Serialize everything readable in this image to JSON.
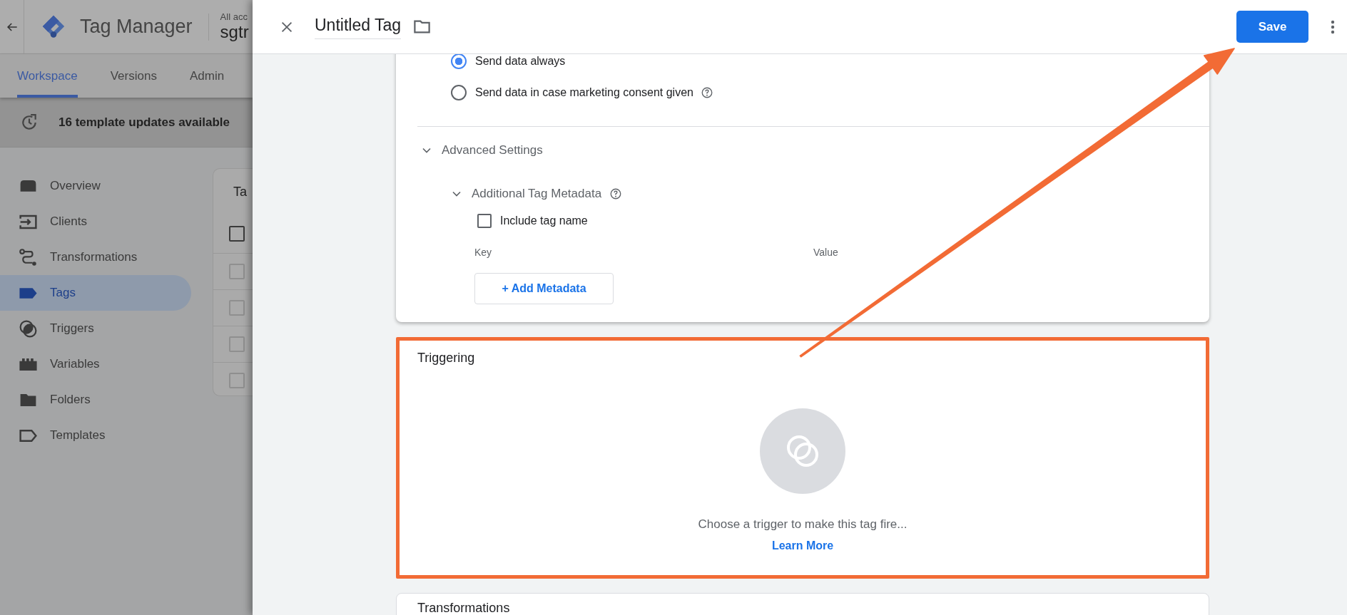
{
  "app": {
    "title": "Tag Manager",
    "account_label": "All acc",
    "container_name": "sgtr"
  },
  "nav_tabs": [
    {
      "label": "Workspace",
      "selected": true
    },
    {
      "label": "Versions",
      "selected": false
    },
    {
      "label": "Admin",
      "selected": false
    }
  ],
  "banner": {
    "text": "16 template updates available"
  },
  "sidebar": {
    "items": [
      {
        "label": "Overview",
        "selected": false
      },
      {
        "label": "Clients",
        "selected": false
      },
      {
        "label": "Transformations",
        "selected": false
      },
      {
        "label": "Tags",
        "selected": true
      },
      {
        "label": "Triggers",
        "selected": false
      },
      {
        "label": "Variables",
        "selected": false
      },
      {
        "label": "Folders",
        "selected": false
      },
      {
        "label": "Templates",
        "selected": false
      }
    ]
  },
  "tags_card": {
    "title": "Ta",
    "header_checkbox": {
      "checked": false
    },
    "rows": [
      {
        "checked": false
      },
      {
        "checked": false
      },
      {
        "checked": false
      },
      {
        "checked": false
      }
    ]
  },
  "editor": {
    "title": "Untitled Tag",
    "save_label": "Save",
    "consent_options": [
      {
        "label": "Send data always",
        "selected": true,
        "help": false
      },
      {
        "label": "Send data in case marketing consent given",
        "selected": false,
        "help": true
      }
    ],
    "advanced": {
      "label": "Advanced Settings",
      "expanded": true
    },
    "metadata": {
      "label": "Additional Tag Metadata",
      "expanded": true,
      "include_tag_name": {
        "label": "Include tag name",
        "checked": false
      },
      "columns": [
        "Key",
        "Value"
      ],
      "add_button": "+ Add Metadata"
    },
    "triggering": {
      "title": "Triggering",
      "message": "Choose a trigger to make this tag fire...",
      "link": "Learn More",
      "highlighted": true
    },
    "next_section": {
      "title": "Transformations"
    }
  }
}
